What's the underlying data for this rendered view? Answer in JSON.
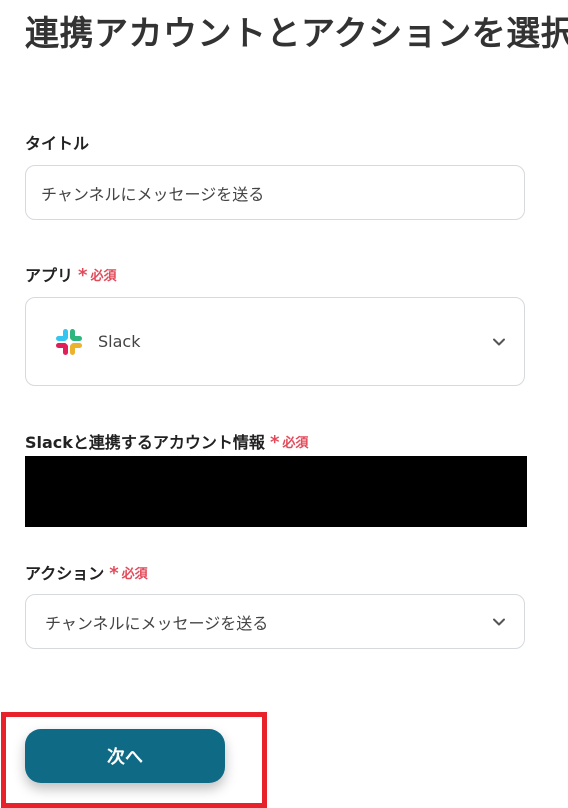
{
  "page": {
    "title": "連携アカウントとアクションを選択"
  },
  "form": {
    "title_field": {
      "label": "タイトル",
      "value": "チャンネルにメッセージを送る"
    },
    "app_field": {
      "label": "アプリ",
      "required_mark": "*",
      "required_text": "必須",
      "value": "Slack",
      "icon": "slack-logo"
    },
    "account_field": {
      "label": "Slackと連携するアカウント情報",
      "required_mark": "*",
      "required_text": "必須"
    },
    "action_field": {
      "label": "アクション",
      "required_mark": "*",
      "required_text": "必須",
      "value": "チャンネルにメッセージを送る"
    }
  },
  "footer": {
    "next_label": "次へ"
  },
  "colors": {
    "primary_button": "#0e6a85",
    "required": "#e34a5a",
    "highlight": "#e8222a",
    "input_border": "#d6d9dd"
  }
}
